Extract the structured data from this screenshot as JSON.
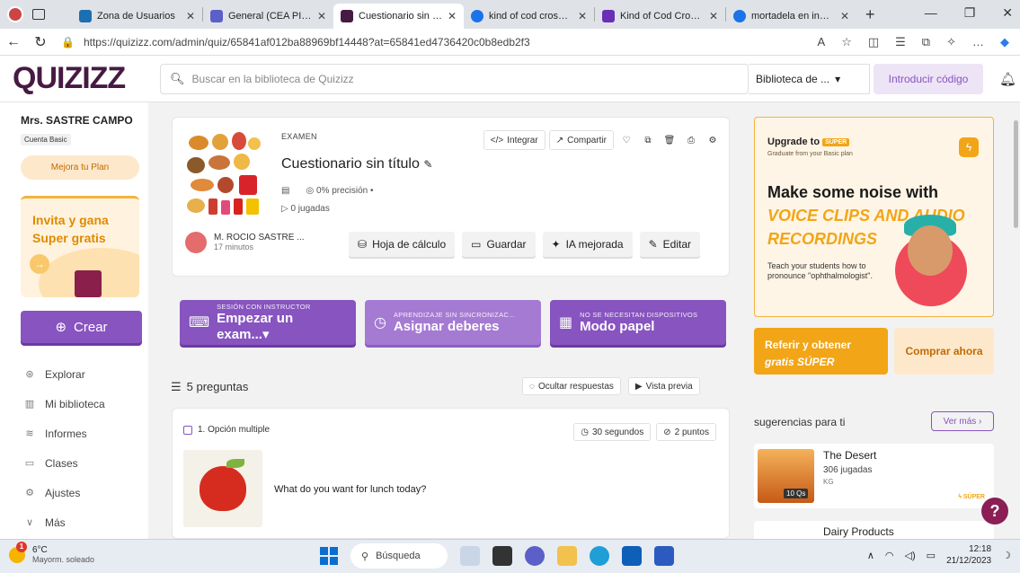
{
  "browser": {
    "tabs": [
      {
        "title": "Zona de Usuarios",
        "color": "#1c6fb0"
      },
      {
        "title": "General (CEA PINARE",
        "color": "#5b5fc7"
      },
      {
        "title": "Cuestionario sin títul",
        "color": "#461a42",
        "active": true
      },
      {
        "title": "kind of cod crosswor",
        "color": "#1a73e8"
      },
      {
        "title": "Kind of Cod Crosswor",
        "color": "#6b2fb5"
      },
      {
        "title": "mortadela en ingles",
        "color": "#1a73e8"
      }
    ],
    "url": "https://quizizz.com/admin/quiz/65841af012ba88969bf14448?at=65841ed4736420c0b8edb2f3"
  },
  "header": {
    "logo": "QUIZIZZ",
    "search_placeholder": "Buscar en la biblioteca de Quizizz",
    "library_select": "Biblioteca de ...",
    "join_code": "Introducir código"
  },
  "sidebar": {
    "user_name": "Mrs. SASTRE CAMPO",
    "plan": "Cuenta Basic",
    "upgrade": "Mejora tu Plan",
    "invite": "Invita y gana Super gratis",
    "create": "Crear",
    "nav": [
      {
        "label": "Explorar",
        "icon": "compass-icon"
      },
      {
        "label": "Mi biblioteca",
        "icon": "library-icon"
      },
      {
        "label": "Informes",
        "icon": "reports-icon"
      },
      {
        "label": "Clases",
        "icon": "classes-icon"
      },
      {
        "label": "Ajustes",
        "icon": "settings-icon"
      },
      {
        "label": "Más",
        "icon": "chevron-down-icon"
      }
    ]
  },
  "quiz": {
    "type": "EXAMEN",
    "title": "Cuestionario sin título",
    "accuracy": "0% precisión",
    "plays": "0 jugadas",
    "author": "M. ROCIO SASTRE ...",
    "time_ago": "17 minutos",
    "actions": {
      "embed": "Integrar",
      "share": "Compartir"
    },
    "buttons": {
      "spreadsheet": "Hoja de cálculo",
      "save": "Guardar",
      "ai": "IA mejorada",
      "edit": "Editar"
    }
  },
  "start": [
    {
      "small": "SESIÓN CON INSTRUCTOR",
      "big": "Empezar un exam..."
    },
    {
      "small": "APRENDIZAJE SIN SINCRONIZAC...",
      "big": "Asignar deberes"
    },
    {
      "small": "NO SE NECESITAN DISPOSITIVOS",
      "big": "Modo papel"
    }
  ],
  "questions": {
    "count": "5 preguntas",
    "hide": "Ocultar respuestas",
    "preview": "Vista previa",
    "first": {
      "type": "1. Opción multiple",
      "time": "30 segundos",
      "points": "2 puntos",
      "text": "What do you want for lunch today?"
    }
  },
  "promo": {
    "upgrade": "Upgrade to",
    "tag": "SUPER",
    "sub": "Graduate from your Basic plan",
    "headline1": "Make some noise with",
    "headline2": "VOICE CLIPS AND AUDIO RECORDINGS",
    "body": "Teach your students how to pronounce \"ophthalmologist\"."
  },
  "refer": {
    "line1": "Referir y obtener",
    "line2": "gratis SÚPER"
  },
  "buy": "Comprar ahora",
  "suggestions": {
    "title": "sugerencias para ti",
    "more": "Ver más",
    "items": [
      {
        "title": "The Desert",
        "plays": "306 jugadas",
        "level": "KG",
        "qs": "10 Qs",
        "badge": "SÚPER"
      },
      {
        "title": "Dairy Products"
      }
    ]
  },
  "taskbar": {
    "temp": "6°C",
    "weather": "Mayorm. soleado",
    "search": "Búsqueda",
    "time": "12:18",
    "date": "21/12/2023",
    "notif": "1"
  }
}
